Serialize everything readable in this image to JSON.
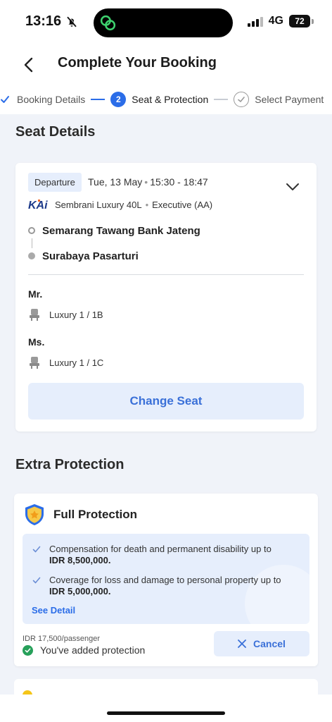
{
  "status_bar": {
    "time": "13:16",
    "network": "4G",
    "battery": "72",
    "icons": [
      "bell-slash-icon",
      "signal-icon",
      "battery-icon"
    ]
  },
  "header": {
    "title": "Complete Your Booking",
    "back_icon": "chevron-left-icon"
  },
  "stepper": {
    "steps": [
      {
        "label": "Booking Details",
        "state": "done"
      },
      {
        "number": "2",
        "label": "Seat & Protection",
        "state": "active"
      },
      {
        "label": "Select Payment",
        "state": "pending"
      }
    ]
  },
  "seat_details": {
    "section_title": "Seat Details",
    "departure_badge": "Departure",
    "date": "Tue, 13 May",
    "time": "15:30 - 18:47",
    "operator_logo_text": "KAi",
    "train": "Sembrani Luxury 40L",
    "class": "Executive (AA)",
    "origin": "Semarang Tawang Bank Jateng",
    "destination": "Surabaya Pasarturi",
    "passengers": [
      {
        "title": "Mr.",
        "seat": "Luxury 1 / 1B"
      },
      {
        "title": "Ms.",
        "seat": "Luxury 1 / 1C"
      }
    ],
    "change_seat_label": "Change Seat"
  },
  "extra_protection": {
    "section_title": "Extra Protection",
    "card_title": "Full Protection",
    "benefits": [
      {
        "text": "Compensation for death and permanent disability up to",
        "amount": "IDR 8,500,000."
      },
      {
        "text": "Coverage for loss and damage to personal property up to",
        "amount": "IDR 5,000,000."
      }
    ],
    "see_detail_label": "See Detail",
    "price": "IDR 17,500/passenger",
    "added_text": "You've added protection",
    "cancel_label": "Cancel"
  },
  "colors": {
    "accent": "#2b6de8",
    "accent_light": "#e6eefc",
    "success": "#27a05a",
    "background": "#f0f3f9"
  }
}
